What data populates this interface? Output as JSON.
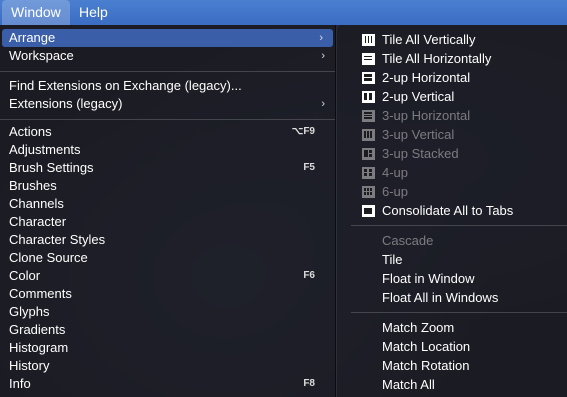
{
  "menubar": {
    "window": "Window",
    "help": "Help"
  },
  "left_menu": {
    "arrange": "Arrange",
    "workspace": "Workspace",
    "find_extensions": "Find Extensions on Exchange (legacy)...",
    "extensions": "Extensions (legacy)",
    "submenu_arrow": "›",
    "panels": [
      {
        "label": "Actions",
        "shortcut": "⌥F9"
      },
      {
        "label": "Adjustments",
        "shortcut": ""
      },
      {
        "label": "Brush Settings",
        "shortcut": "F5"
      },
      {
        "label": "Brushes",
        "shortcut": ""
      },
      {
        "label": "Channels",
        "shortcut": ""
      },
      {
        "label": "Character",
        "shortcut": ""
      },
      {
        "label": "Character Styles",
        "shortcut": ""
      },
      {
        "label": "Clone Source",
        "shortcut": ""
      },
      {
        "label": "Color",
        "shortcut": "F6"
      },
      {
        "label": "Comments",
        "shortcut": ""
      },
      {
        "label": "Glyphs",
        "shortcut": ""
      },
      {
        "label": "Gradients",
        "shortcut": ""
      },
      {
        "label": "Histogram",
        "shortcut": ""
      },
      {
        "label": "History",
        "shortcut": ""
      },
      {
        "label": "Info",
        "shortcut": "F8"
      }
    ]
  },
  "arrange_menu": {
    "tile_all_vertically": "Tile All Vertically",
    "tile_all_horizontally": "Tile All Horizontally",
    "two_up_horizontal": "2-up Horizontal",
    "two_up_vertical": "2-up Vertical",
    "three_up_horizontal": "3-up Horizontal",
    "three_up_vertical": "3-up Vertical",
    "three_up_stacked": "3-up Stacked",
    "four_up": "4-up",
    "six_up": "6-up",
    "consolidate": "Consolidate All to Tabs",
    "cascade": "Cascade",
    "tile": "Tile",
    "float_in_window": "Float in Window",
    "float_all_in_windows": "Float All in Windows",
    "match_zoom": "Match Zoom",
    "match_location": "Match Location",
    "match_rotation": "Match Rotation",
    "match_all": "Match All"
  },
  "colors": {
    "menubar": "#3b6dc3",
    "highlight": "#3a5ea8",
    "disabled_text": "#7c7c80"
  }
}
